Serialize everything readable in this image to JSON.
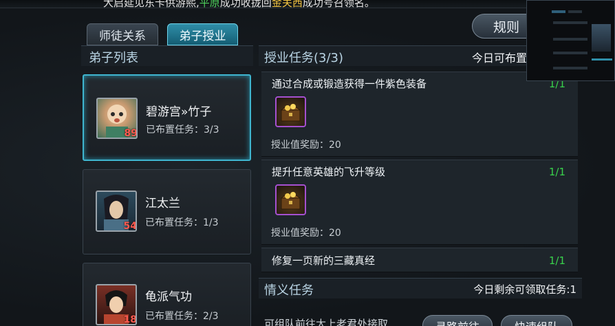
{
  "banner": {
    "ticker_pre": "大启延见东卡供游熙,",
    "ticker_green": "平原",
    "ticker_mid": "成功收拢回",
    "ticker_yellow": "金关西",
    "ticker_post": "成功号召领名。"
  },
  "tabs": [
    {
      "label": "师徒关系",
      "active": false
    },
    {
      "label": "弟子授业",
      "active": true
    }
  ],
  "rules_label": "规则",
  "disciple_list": {
    "header": "弟子列表",
    "items": [
      {
        "name": "碧游宫»竹子",
        "level": "89",
        "tasks": "已布置任务：3/3",
        "selected": true
      },
      {
        "name": "江太兰",
        "level": "54",
        "tasks": "已布置任务：1/3",
        "selected": false
      },
      {
        "name": "龟派气功",
        "level": "18",
        "tasks": "已布置任务：2/3",
        "selected": false
      }
    ]
  },
  "teaching": {
    "title": "授业任务(3/3)",
    "today_label": "今日可布置",
    "tasks": [
      {
        "name": "通过合成或锻造获得一件紫色装备",
        "progress": "1/1",
        "reward": "授业值奖励：20"
      },
      {
        "name": "提升任意英雄的飞升等级",
        "progress": "1/1",
        "reward": "授业值奖励：20"
      },
      {
        "name": "修复一页新的三藏真经",
        "progress": "1/1",
        "reward": ""
      }
    ]
  },
  "relation": {
    "title": "情义任务",
    "remain": "今日剩余可领取任务:1",
    "party_text": "可组队前往太上老君处接取",
    "seek_label": "寻路前往",
    "quick_label": "快速组队"
  },
  "colors": {
    "accent": "#3fb6d0",
    "progress_green": "#39d24c",
    "level_red": "#ff5a4f",
    "item_purple": "#a550d0"
  },
  "icons": [
    "treasure-chest-icon",
    "avatar-portrait"
  ]
}
